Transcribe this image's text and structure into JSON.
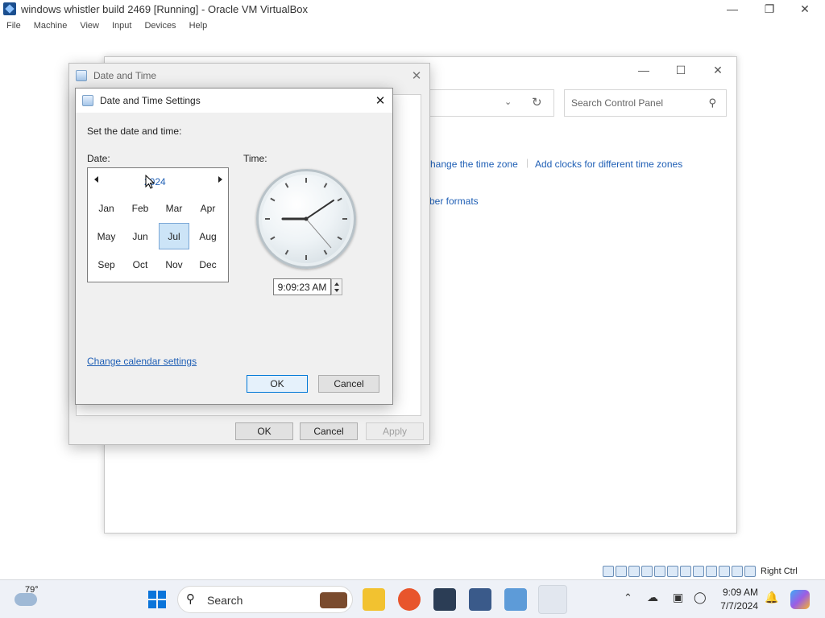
{
  "vbox": {
    "title": "windows whistler build 2469 [Running] - Oracle VM VirtualBox",
    "menu": [
      "File",
      "Machine",
      "View",
      "Input",
      "Devices",
      "Help"
    ],
    "host_key": "Right Ctrl"
  },
  "control_panel": {
    "search_placeholder": "Search Control Panel",
    "link_timezone": "hange the time zone",
    "link_clocks": "Add clocks for different time zones",
    "link_formats": "ber formats",
    "btn_partial": "...",
    "fragment_text": "he"
  },
  "date_time_dialog": {
    "title": "Date and Time",
    "ok": "OK",
    "cancel": "Cancel",
    "apply": "Apply"
  },
  "settings_dialog": {
    "title": "Date and Time Settings",
    "prompt": "Set the date and time:",
    "date_label": "Date:",
    "time_label": "Time:",
    "year": "2024",
    "months": [
      "Jan",
      "Feb",
      "Mar",
      "Apr",
      "May",
      "Jun",
      "Jul",
      "Aug",
      "Sep",
      "Oct",
      "Nov",
      "Dec"
    ],
    "selected_month": "Jul",
    "time_value": "9:09:23 AM",
    "change_calendar": "Change calendar settings",
    "ok": "OK",
    "cancel": "Cancel"
  },
  "taskbar": {
    "weather": "79°",
    "search_label": "Search",
    "clock_time": "9:09 AM",
    "clock_date": "7/7/2024"
  },
  "colors": {
    "accent": "#0078d7",
    "link": "#1f5fb5",
    "selected_month_bg": "#cce4f7"
  }
}
